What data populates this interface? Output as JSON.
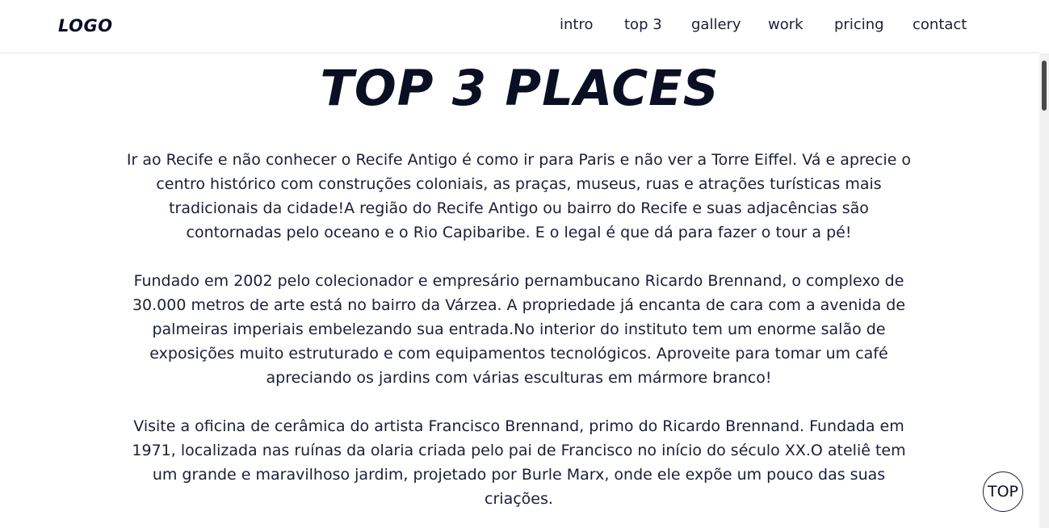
{
  "header": {
    "logo": "LOGO",
    "nav": [
      {
        "label": "intro"
      },
      {
        "label": "top 3"
      },
      {
        "label": "gallery"
      },
      {
        "label": "work"
      },
      {
        "label": "pricing"
      },
      {
        "label": "contact"
      }
    ]
  },
  "main": {
    "title": "TOP 3 PLACES",
    "paragraphs": [
      "Ir ao Recife e não conhecer o Recife Antigo é como ir para Paris e não ver a Torre Eiffel. Vá e aprecie o centro histórico com construções coloniais, as praças, museus, ruas e atrações turísticas mais tradicionais da cidade!A região do Recife Antigo ou bairro do Recife e suas adjacências são contornadas pelo oceano e o Rio Capibaribe. E o legal é que dá para fazer o tour a pé!",
      "Fundado em 2002 pelo colecionador e empresário pernambucano Ricardo Brennand, o complexo de 30.000 metros de arte está no bairro da Várzea. A propriedade já encanta de cara com a avenida de palmeiras imperiais embelezando sua entrada.No interior do instituto tem um enorme salão de exposições muito estruturado e com equipamentos tecnológicos. Aproveite para tomar um café apreciando os jardins com várias esculturas em mármore branco!",
      "Visite a oficina de cerâmica do artista Francisco Brennand, primo do Ricardo Brennand. Fundada em 1971, localizada nas ruínas da olaria criada pelo pai de Francisco no início do século XX.O ateliê tem um grande e maravilhoso jardim, projetado por Burle Marx, onde ele expõe um pouco das suas criações."
    ]
  },
  "scroll_top_button": {
    "label": "TOP"
  },
  "colors": {
    "text": "#1b1f38",
    "heading": "#0b0f24",
    "background": "#ffffff"
  }
}
